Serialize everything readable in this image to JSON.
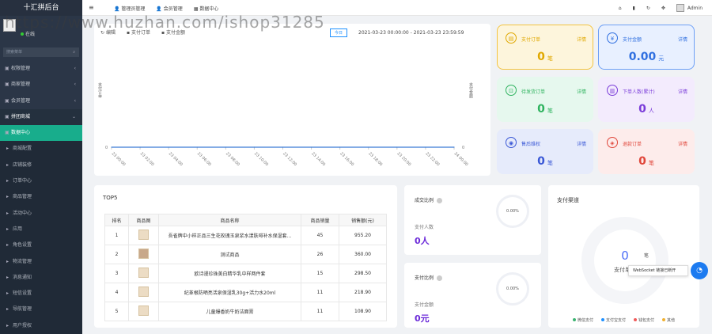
{
  "sidebar": {
    "title": "十汇拼后台",
    "online": "在线",
    "search_placeholder": "搜索菜单",
    "items": [
      {
        "label": "权限管理",
        "state": "normal"
      },
      {
        "label": "商家管理",
        "state": "normal"
      },
      {
        "label": "会员管理",
        "state": "normal"
      },
      {
        "label": "拼团商城",
        "state": "open"
      },
      {
        "label": "数据中心",
        "state": "active"
      },
      {
        "label": "商城配置",
        "state": "sub"
      },
      {
        "label": "店铺装修",
        "state": "sub"
      },
      {
        "label": "订单中心",
        "state": "sub"
      },
      {
        "label": "商品管理",
        "state": "sub"
      },
      {
        "label": "活动中心",
        "state": "sub"
      },
      {
        "label": "应用",
        "state": "sub"
      },
      {
        "label": "角色设置",
        "state": "sub"
      },
      {
        "label": "物流管理",
        "state": "sub"
      },
      {
        "label": "消息通知",
        "state": "sub"
      },
      {
        "label": "短信设置",
        "state": "sub"
      },
      {
        "label": "导航管理",
        "state": "sub"
      },
      {
        "label": "用户授权",
        "state": "sub"
      }
    ]
  },
  "topbar": {
    "tabs": [
      "管理员管理",
      "会员管理",
      "数据中心"
    ],
    "admin": "Admin"
  },
  "chart": {
    "tools": [
      "编辑",
      "支付订单",
      "支付金额"
    ],
    "btn": "今日",
    "range": "2021-03-23 00:00:00  -  2021-03-23 23:59:59",
    "y_left": "支付订单",
    "y_right": "支付金额"
  },
  "chart_data": {
    "type": "line",
    "x": [
      "23 00:00",
      "23 02:00",
      "23 04:00",
      "23 06:00",
      "23 08:00",
      "23 10:00",
      "23 12:00",
      "23 14:00",
      "23 16:00",
      "23 18:00",
      "23 20:00",
      "23 22:00",
      "24 00:00"
    ],
    "series": [
      {
        "name": "支付订单",
        "values": [
          0,
          0,
          0,
          0,
          0,
          0,
          0,
          0,
          0,
          0,
          0,
          0,
          0
        ]
      }
    ],
    "ylim": [
      0,
      0
    ],
    "y_left_tick": "0",
    "y_right_tick": "0"
  },
  "stats": [
    {
      "label": "支付订单",
      "detail": "详情",
      "value": "0",
      "unit": "笔",
      "bg": "#fdf5dc",
      "border": "#f3c440",
      "accent": "#e0a800",
      "icon": "order-icon",
      "glyph": "▤"
    },
    {
      "label": "支付金额",
      "detail": "详情",
      "value": "0.00",
      "unit": "元",
      "bg": "#e8f0ff",
      "border": "#6ea0f6",
      "accent": "#2f6fe0",
      "icon": "money-icon",
      "glyph": "¥"
    },
    {
      "label": "待发货订单",
      "detail": "详情",
      "value": "0",
      "unit": "笔",
      "bg": "#e6f8ee",
      "border": "#e6f8ee",
      "accent": "#2fb35f",
      "icon": "truck-icon",
      "glyph": "⊡"
    },
    {
      "label": "下单人数(累计)",
      "detail": "详情",
      "value": "0",
      "unit": "人",
      "bg": "#f3ebfd",
      "border": "#f3ebfd",
      "accent": "#7a3cd9",
      "icon": "clipboard-icon",
      "glyph": "▥"
    },
    {
      "label": "售后维权",
      "detail": "详情",
      "value": "0",
      "unit": "笔",
      "bg": "#e6ebfb",
      "border": "#e6ebfb",
      "accent": "#3a58d6",
      "icon": "service-icon",
      "glyph": "◉"
    },
    {
      "label": "退款订单",
      "detail": "详情",
      "value": "0",
      "unit": "笔",
      "bg": "#fdeceb",
      "border": "#fdeceb",
      "accent": "#e0463a",
      "icon": "box-icon",
      "glyph": "◈"
    }
  ],
  "top5": {
    "title": "TOP5",
    "headers": [
      "排名",
      "商品图",
      "商品名称",
      "商品销量",
      "销售额(元)"
    ],
    "rows": [
      {
        "rank": "1",
        "name": "吾雀牌中小样正品三生花玫瑰玉泉浆水漾肤啡补水保湿套...",
        "sales": "45",
        "amount": "955.20",
        "img": "light"
      },
      {
        "rank": "2",
        "name": "测试商品",
        "sales": "26",
        "amount": "360.00",
        "img": "dark"
      },
      {
        "rank": "3",
        "name": "欧诗漫珍珠美白精华乳中样两件套",
        "sales": "15",
        "amount": "298.50",
        "img": "light"
      },
      {
        "rank": "4",
        "name": "纪革根防晒亮活泉保湿乳30g+活力水20ml",
        "sales": "11",
        "amount": "218.90",
        "img": "light"
      },
      {
        "rank": "5",
        "name": "儿童爆香奶牛奶洁面膏",
        "sales": "11",
        "amount": "108.90",
        "img": "light"
      }
    ]
  },
  "conv1": {
    "title": "成交比例",
    "sub": "支付人数",
    "value": "0人",
    "pct": "0.00%"
  },
  "conv2": {
    "title": "支付比例",
    "sub": "支付金额",
    "value": "0元",
    "pct": "0.00%"
  },
  "pay": {
    "title": "支付渠道",
    "num": "0",
    "unit": "笔",
    "label": "支付单量",
    "legend": [
      {
        "name": "微信支付",
        "color": "#3cb371"
      },
      {
        "name": "支付宝支付",
        "color": "#1e90ff"
      },
      {
        "name": "钱包支付",
        "color": "#f05a5a"
      },
      {
        "name": "其他",
        "color": "#f0b030"
      }
    ]
  },
  "toast": "WebSocket 链接已断开",
  "watermark": "https://www.huzhan.com/ishop31285"
}
